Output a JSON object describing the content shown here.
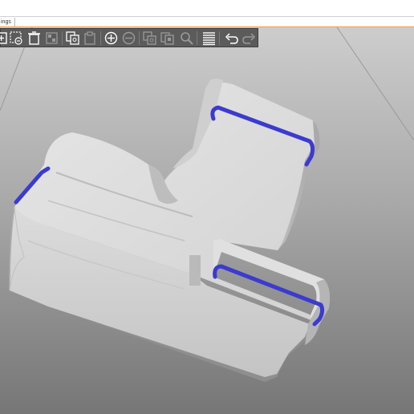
{
  "tabs": [
    {
      "label": "ings",
      "active": true
    }
  ],
  "accent_color": "#ff9a3c",
  "toolbar": {
    "buttons": [
      {
        "name": "add-icon",
        "enabled": true
      },
      {
        "name": "delete-icon",
        "enabled": true
      },
      {
        "name": "delete-all-icon",
        "enabled": true
      },
      {
        "name": "arrange-icon",
        "enabled": false
      },
      {
        "name": "copy-icon",
        "enabled": true
      },
      {
        "name": "paste-icon",
        "enabled": false
      },
      {
        "name": "add-instance-icon",
        "enabled": true
      },
      {
        "name": "remove-instance-icon",
        "enabled": false
      },
      {
        "name": "split-to-objects-icon",
        "enabled": false
      },
      {
        "name": "split-to-parts-icon",
        "enabled": false
      },
      {
        "name": "search-icon",
        "enabled": false
      },
      {
        "name": "layers-editing-icon",
        "enabled": true
      },
      {
        "name": "undo-icon",
        "enabled": true
      },
      {
        "name": "redo-icon",
        "enabled": false
      }
    ]
  },
  "scene": {
    "background_top": "#c8c8c8",
    "background_bottom": "#7a7a7a",
    "model_color": "#d8d8d8",
    "highlight_color": "#3b3bd0"
  }
}
